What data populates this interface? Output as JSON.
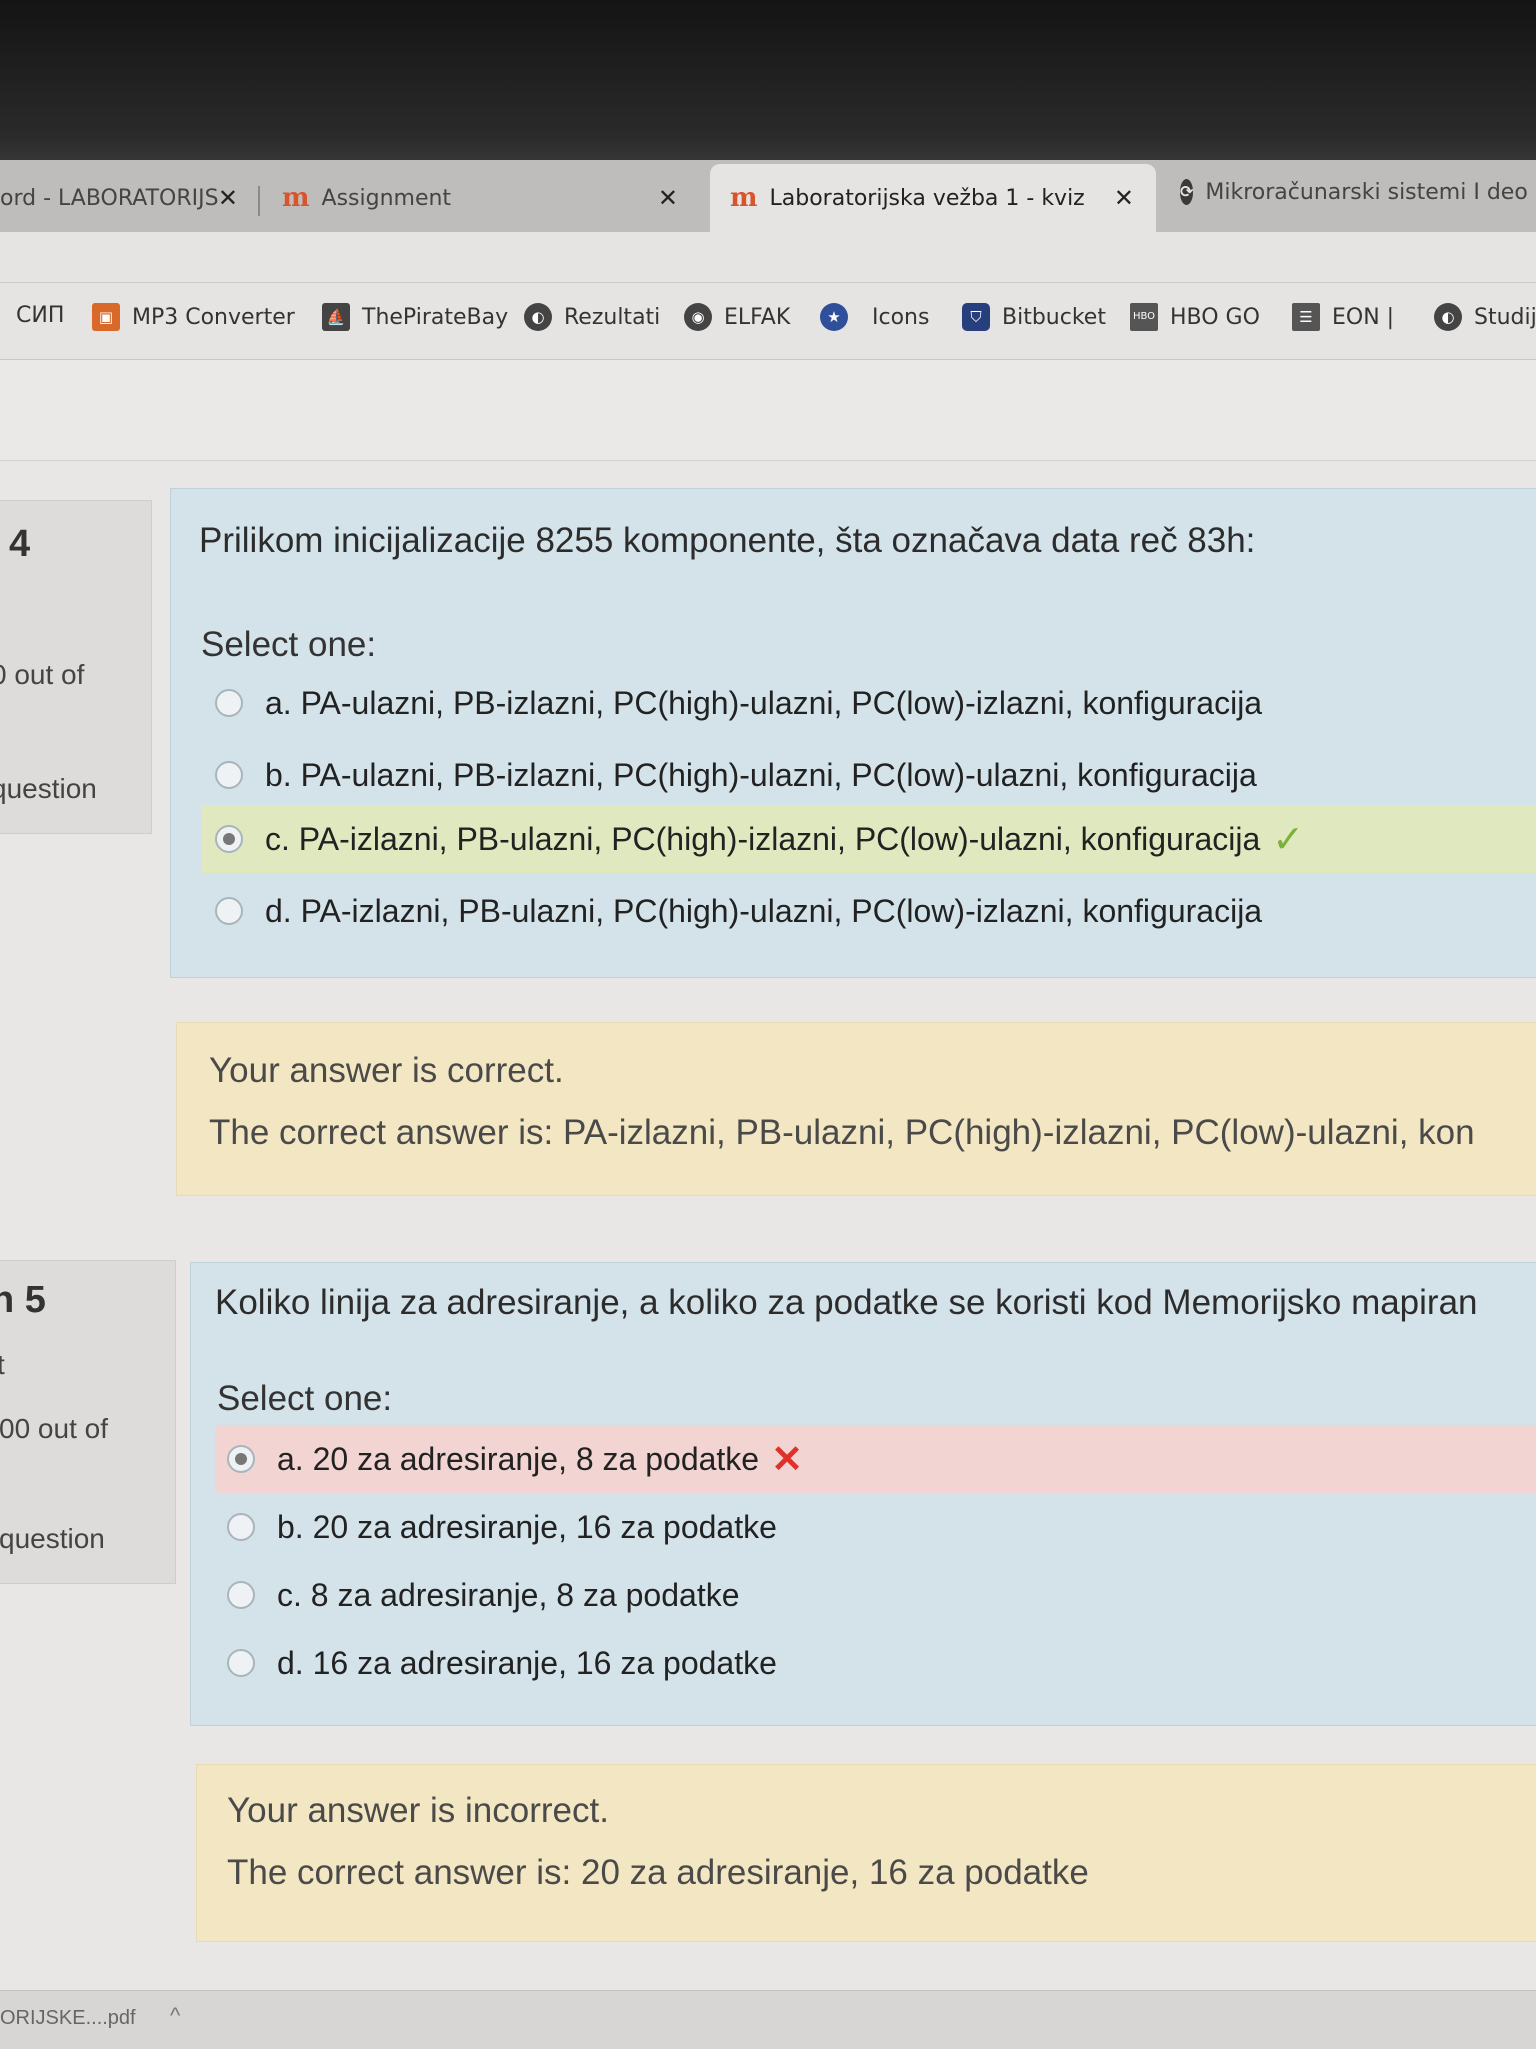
{
  "tabs": [
    {
      "title": "ord - LABORATORIJS",
      "close": "✕"
    },
    {
      "title": "Assignment",
      "close": "✕"
    },
    {
      "title": "Laboratorijska vežba 1 - kviz",
      "close": "✕",
      "active": true
    },
    {
      "title": "Mikroračunarski sistemi I deo r"
    }
  ],
  "bookmarks": [
    "СИП",
    "MP3 Converter",
    "ThePirateBay",
    "Rezultati",
    "ELFAK",
    "Icons",
    "Bitbucket",
    "HBO GO",
    "EON |",
    "Studij"
  ],
  "question4": {
    "number": "4",
    "info_lines": [
      "0 out of",
      "question"
    ],
    "text": "Prilikom inicijalizacije 8255 komponente, šta označava data reč 83h:",
    "select_label": "Select one:",
    "options": [
      "a. PA-ulazni, PB-izlazni, PC(high)-ulazni, PC(low)-izlazni, konfiguracija",
      "b. PA-ulazni, PB-izlazni, PC(high)-ulazni, PC(low)-ulazni, konfiguracija",
      "c. PA-izlazni, PB-ulazni, PC(high)-izlazni, PC(low)-ulazni, konfiguracija",
      "d. PA-izlazni, PB-ulazni, PC(high)-ulazni, PC(low)-izlazni, konfiguracija"
    ],
    "feedback_status": "Your answer is correct.",
    "feedback_answer": "The correct answer is: PA-izlazni, PB-ulazni, PC(high)-izlazni, PC(low)-ulazni, kon"
  },
  "question5": {
    "number": "n 5",
    "info_lines": [
      "t",
      "00 out of",
      " question"
    ],
    "text": "Koliko linija za adresiranje, a koliko za podatke se koristi kod Memorijsko mapiran",
    "select_label": "Select one:",
    "options": [
      "a. 20 za adresiranje, 8 za podatke",
      "b. 20 za adresiranje, 16 za podatke",
      "c. 8 za adresiranje, 8 za podatke",
      "d. 16 za adresiranje, 16 za podatke"
    ],
    "feedback_status": "Your answer is incorrect.",
    "feedback_answer": "The correct answer is: 20 za adresiranje, 16 za podatke"
  },
  "download_bar": {
    "file": "ORIJSKE....pdf",
    "chevron": "^"
  },
  "colors": {
    "correct_mark": "#7bb33a",
    "incorrect_mark": "#e0302a",
    "question_bg": "#d4e3ea",
    "feedback_bg": "#f3e6c2"
  }
}
